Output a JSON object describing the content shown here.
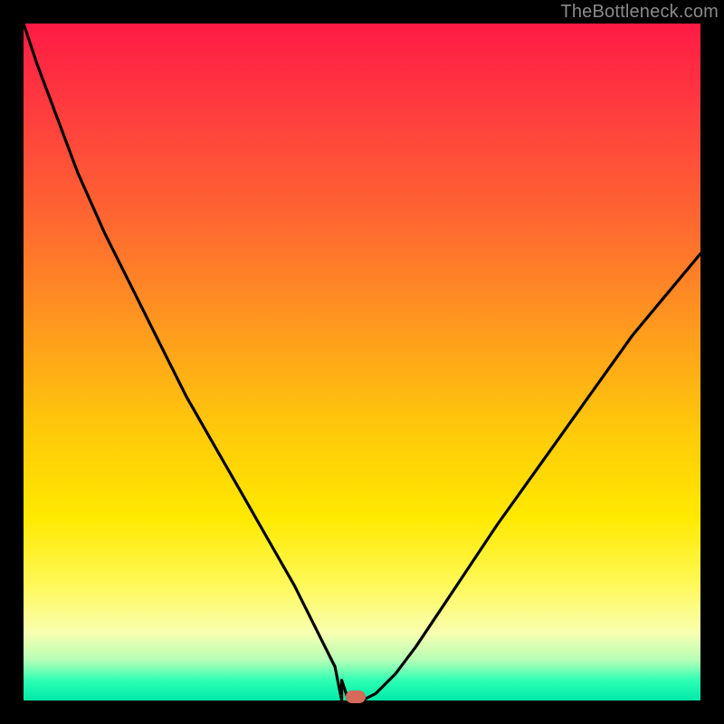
{
  "watermark": "TheBottleneck.com",
  "colors": {
    "background": "#000000",
    "gradient_top": "#ff1a44",
    "gradient_mid_orange": "#ff9a1e",
    "gradient_mid_yellow": "#ffe900",
    "gradient_bottom_green": "#00e8a8",
    "curve_stroke": "#000000",
    "marker_fill": "#d66a5a",
    "watermark_text": "#8a8a8a"
  },
  "chart_data": {
    "type": "line",
    "title": "",
    "xlabel": "",
    "ylabel": "",
    "xlim": [
      0,
      100
    ],
    "ylim": [
      0,
      100
    ],
    "x": [
      0,
      2,
      5,
      8,
      12,
      16,
      20,
      24,
      28,
      32,
      36,
      40,
      42,
      44,
      46,
      47,
      48,
      50,
      52,
      55,
      58,
      62,
      66,
      70,
      75,
      80,
      85,
      90,
      95,
      100
    ],
    "values": [
      100,
      94,
      86,
      78,
      69,
      61,
      53,
      45,
      38,
      31,
      24,
      17,
      13,
      9,
      5,
      3,
      1,
      0,
      1,
      4,
      8,
      14,
      20,
      26,
      33,
      40,
      47,
      54,
      60,
      66
    ],
    "min_point_x": 50,
    "min_point_y": 0,
    "min_plateau": {
      "x_start": 46,
      "x_end": 50,
      "y": 0
    },
    "marker": {
      "x": 49,
      "y": 0.5
    },
    "annotations": []
  }
}
